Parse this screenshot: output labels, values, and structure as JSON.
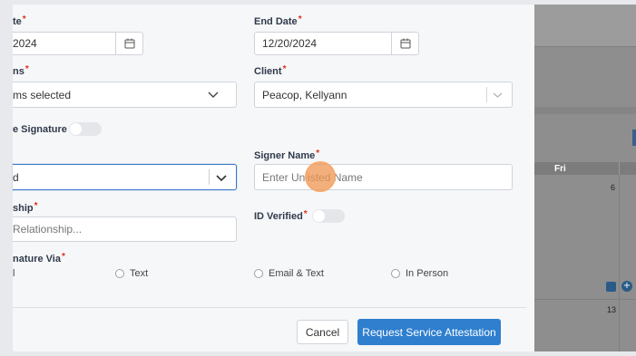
{
  "form": {
    "start_date": {
      "label": "te",
      "value": "2024"
    },
    "end_date": {
      "label": "End Date",
      "value": "12/20/2024"
    },
    "items": {
      "label": "ns",
      "value": "ms selected"
    },
    "client": {
      "label": "Client",
      "value": "Peacop, Kellyann"
    },
    "signature": {
      "label": "e Signature"
    },
    "signer_type": {
      "value": "d"
    },
    "signer_name": {
      "label": "Signer Name",
      "placeholder": "Enter Unlisted Name"
    },
    "relationship": {
      "label": "ship",
      "placeholder": "Relationship..."
    },
    "id_verified": {
      "label": "ID Verified"
    },
    "signature_via": {
      "label": "nature Via",
      "options": [
        "l",
        "Text",
        "Email & Text",
        "In Person"
      ]
    },
    "required_mark": "*"
  },
  "footer": {
    "cancel_label": "Cancel",
    "submit_label": "Request Service Attestation"
  },
  "calendar": {
    "day_header": "Fri",
    "day_numbers": [
      "6",
      "13"
    ]
  },
  "colors": {
    "primary": "#2f7fce",
    "required": "#e0301e",
    "focus_border": "#3b78c7",
    "overlay": "#8e8e8e"
  },
  "icons": [
    "calendar-icon",
    "chevron-down-icon",
    "folder-icon",
    "plus-circle-icon"
  ]
}
